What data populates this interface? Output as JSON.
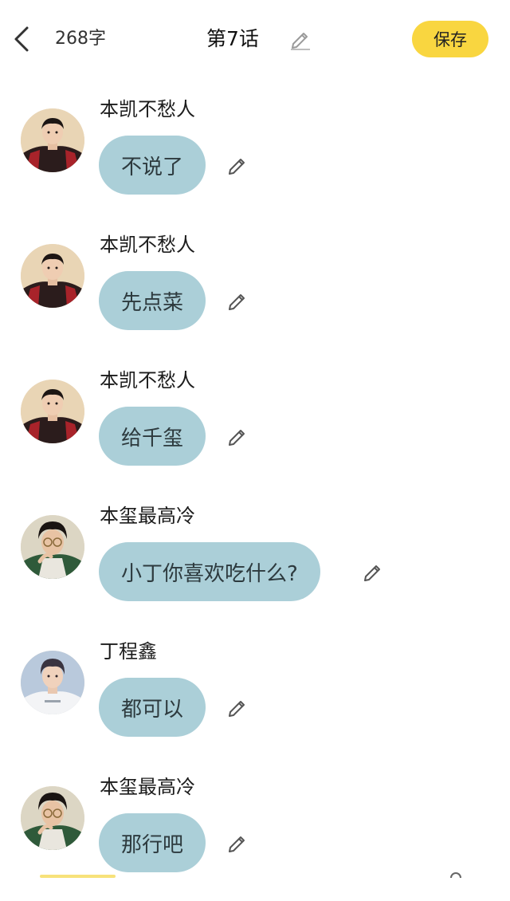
{
  "header": {
    "word_count": "268字",
    "chapter_title": "第7话",
    "save_label": "保存",
    "accent_color": "#f9d640"
  },
  "messages": [
    {
      "sender": "本凯不愁人",
      "text": "不说了",
      "avatar": "avatar-kai"
    },
    {
      "sender": "本凯不愁人",
      "text": "先点菜",
      "avatar": "avatar-kai"
    },
    {
      "sender": "本凯不愁人",
      "text": "给千玺",
      "avatar": "avatar-kai"
    },
    {
      "sender": "本玺最高冷",
      "text": "小丁你喜欢吃什么?",
      "avatar": "avatar-xi"
    },
    {
      "sender": "丁程鑫",
      "text": "都可以",
      "avatar": "avatar-ding"
    },
    {
      "sender": "本玺最高冷",
      "text": "那行吧",
      "avatar": "avatar-xi"
    }
  ],
  "colors": {
    "bubble": "#abcfd8",
    "bubble_text": "#2d3a3e",
    "icon_gray": "#555555"
  }
}
